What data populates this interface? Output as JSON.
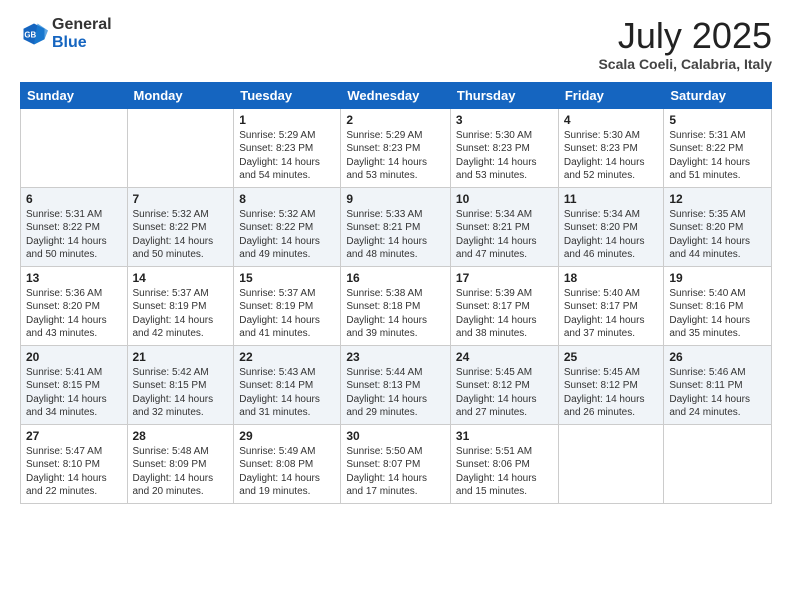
{
  "header": {
    "logo_general": "General",
    "logo_blue": "Blue",
    "month_title": "July 2025",
    "location": "Scala Coeli, Calabria, Italy"
  },
  "weekdays": [
    "Sunday",
    "Monday",
    "Tuesday",
    "Wednesday",
    "Thursday",
    "Friday",
    "Saturday"
  ],
  "weeks": [
    [
      {
        "day": "",
        "content": ""
      },
      {
        "day": "",
        "content": ""
      },
      {
        "day": "1",
        "content": "Sunrise: 5:29 AM\nSunset: 8:23 PM\nDaylight: 14 hours\nand 54 minutes."
      },
      {
        "day": "2",
        "content": "Sunrise: 5:29 AM\nSunset: 8:23 PM\nDaylight: 14 hours\nand 53 minutes."
      },
      {
        "day": "3",
        "content": "Sunrise: 5:30 AM\nSunset: 8:23 PM\nDaylight: 14 hours\nand 53 minutes."
      },
      {
        "day": "4",
        "content": "Sunrise: 5:30 AM\nSunset: 8:23 PM\nDaylight: 14 hours\nand 52 minutes."
      },
      {
        "day": "5",
        "content": "Sunrise: 5:31 AM\nSunset: 8:22 PM\nDaylight: 14 hours\nand 51 minutes."
      }
    ],
    [
      {
        "day": "6",
        "content": "Sunrise: 5:31 AM\nSunset: 8:22 PM\nDaylight: 14 hours\nand 50 minutes."
      },
      {
        "day": "7",
        "content": "Sunrise: 5:32 AM\nSunset: 8:22 PM\nDaylight: 14 hours\nand 50 minutes."
      },
      {
        "day": "8",
        "content": "Sunrise: 5:32 AM\nSunset: 8:22 PM\nDaylight: 14 hours\nand 49 minutes."
      },
      {
        "day": "9",
        "content": "Sunrise: 5:33 AM\nSunset: 8:21 PM\nDaylight: 14 hours\nand 48 minutes."
      },
      {
        "day": "10",
        "content": "Sunrise: 5:34 AM\nSunset: 8:21 PM\nDaylight: 14 hours\nand 47 minutes."
      },
      {
        "day": "11",
        "content": "Sunrise: 5:34 AM\nSunset: 8:20 PM\nDaylight: 14 hours\nand 46 minutes."
      },
      {
        "day": "12",
        "content": "Sunrise: 5:35 AM\nSunset: 8:20 PM\nDaylight: 14 hours\nand 44 minutes."
      }
    ],
    [
      {
        "day": "13",
        "content": "Sunrise: 5:36 AM\nSunset: 8:20 PM\nDaylight: 14 hours\nand 43 minutes."
      },
      {
        "day": "14",
        "content": "Sunrise: 5:37 AM\nSunset: 8:19 PM\nDaylight: 14 hours\nand 42 minutes."
      },
      {
        "day": "15",
        "content": "Sunrise: 5:37 AM\nSunset: 8:19 PM\nDaylight: 14 hours\nand 41 minutes."
      },
      {
        "day": "16",
        "content": "Sunrise: 5:38 AM\nSunset: 8:18 PM\nDaylight: 14 hours\nand 39 minutes."
      },
      {
        "day": "17",
        "content": "Sunrise: 5:39 AM\nSunset: 8:17 PM\nDaylight: 14 hours\nand 38 minutes."
      },
      {
        "day": "18",
        "content": "Sunrise: 5:40 AM\nSunset: 8:17 PM\nDaylight: 14 hours\nand 37 minutes."
      },
      {
        "day": "19",
        "content": "Sunrise: 5:40 AM\nSunset: 8:16 PM\nDaylight: 14 hours\nand 35 minutes."
      }
    ],
    [
      {
        "day": "20",
        "content": "Sunrise: 5:41 AM\nSunset: 8:15 PM\nDaylight: 14 hours\nand 34 minutes."
      },
      {
        "day": "21",
        "content": "Sunrise: 5:42 AM\nSunset: 8:15 PM\nDaylight: 14 hours\nand 32 minutes."
      },
      {
        "day": "22",
        "content": "Sunrise: 5:43 AM\nSunset: 8:14 PM\nDaylight: 14 hours\nand 31 minutes."
      },
      {
        "day": "23",
        "content": "Sunrise: 5:44 AM\nSunset: 8:13 PM\nDaylight: 14 hours\nand 29 minutes."
      },
      {
        "day": "24",
        "content": "Sunrise: 5:45 AM\nSunset: 8:12 PM\nDaylight: 14 hours\nand 27 minutes."
      },
      {
        "day": "25",
        "content": "Sunrise: 5:45 AM\nSunset: 8:12 PM\nDaylight: 14 hours\nand 26 minutes."
      },
      {
        "day": "26",
        "content": "Sunrise: 5:46 AM\nSunset: 8:11 PM\nDaylight: 14 hours\nand 24 minutes."
      }
    ],
    [
      {
        "day": "27",
        "content": "Sunrise: 5:47 AM\nSunset: 8:10 PM\nDaylight: 14 hours\nand 22 minutes."
      },
      {
        "day": "28",
        "content": "Sunrise: 5:48 AM\nSunset: 8:09 PM\nDaylight: 14 hours\nand 20 minutes."
      },
      {
        "day": "29",
        "content": "Sunrise: 5:49 AM\nSunset: 8:08 PM\nDaylight: 14 hours\nand 19 minutes."
      },
      {
        "day": "30",
        "content": "Sunrise: 5:50 AM\nSunset: 8:07 PM\nDaylight: 14 hours\nand 17 minutes."
      },
      {
        "day": "31",
        "content": "Sunrise: 5:51 AM\nSunset: 8:06 PM\nDaylight: 14 hours\nand 15 minutes."
      },
      {
        "day": "",
        "content": ""
      },
      {
        "day": "",
        "content": ""
      }
    ]
  ]
}
